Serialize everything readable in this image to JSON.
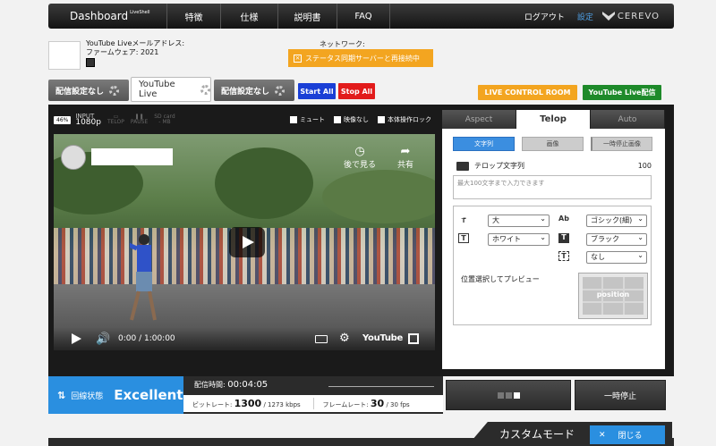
{
  "nav": {
    "brand": "Dashboard",
    "brand_sub": "LiveShell",
    "items": [
      "特徴",
      "仕様",
      "説明書",
      "FAQ"
    ],
    "logout": "ログアウト",
    "settings": "設定",
    "logo": "CEREVO"
  },
  "device": {
    "email_label": "YouTube Liveメールアドレス:",
    "firmware_label": "ファームウェア: 2021",
    "network_label": "ネットワーク:",
    "network_status": "ステータス同期サーバーと再接続中"
  },
  "source_tabs": [
    {
      "label": "配信設定なし",
      "active": false
    },
    {
      "label": "YouTube Live",
      "active": true
    },
    {
      "label": "配信設定なし",
      "active": false
    }
  ],
  "actions": {
    "start_all": "Start All",
    "stop_all": "Stop All",
    "live_control_room": "LIVE CONTROL ROOM",
    "youtube_live": "YouTube Live配信"
  },
  "colors": {
    "start": "#1a3fd6",
    "stop": "#e21b1b",
    "control_room": "#f3a520",
    "youtube_live": "#1e8a2a",
    "accent_blue": "#2a8fe0"
  },
  "status": {
    "battery": "46%",
    "input_label": "INPUT",
    "resolution": "1080p",
    "icons": [
      "TELOP",
      "PAUSE",
      "SD card"
    ],
    "sd_size": "- MB",
    "checkboxes": [
      "ミュート",
      "映像なし",
      "本体操作ロック"
    ]
  },
  "player": {
    "watch_later": "後で見る",
    "share": "共有",
    "time": "0:00 / 1:00:00",
    "logo": "YouTube"
  },
  "panel": {
    "tabs": [
      "Aspect",
      "Telop",
      "Auto"
    ],
    "subtabs": [
      "文字列",
      "画像",
      "一時停止画像"
    ],
    "telop_label": "テロップ文字列",
    "telop_count": "100",
    "telop_placeholder": "最大100文字まで入力できます",
    "size_select": "大",
    "font_select": "ゴシック(細)",
    "color_select": "ホワイト",
    "bgcolor_select": "ブラック",
    "border_select": "なし",
    "position_label": "位置選択してプレビュー",
    "position_text": "position"
  },
  "stream": {
    "state_label": "回線状態",
    "state_value": "Excellent",
    "duration_label": "配信時間:",
    "duration_value": "00:04:05",
    "bitrate_label": "ビットレート:",
    "bitrate_value": "1300",
    "bitrate_total": "/ 1273 kbps",
    "framerate_label": "フレームレート:",
    "framerate_value": "30",
    "framerate_total": "/ 30 fps",
    "pause": "一時停止"
  },
  "footer": {
    "custom_mode": "カスタムモード",
    "close": "閉じる"
  }
}
